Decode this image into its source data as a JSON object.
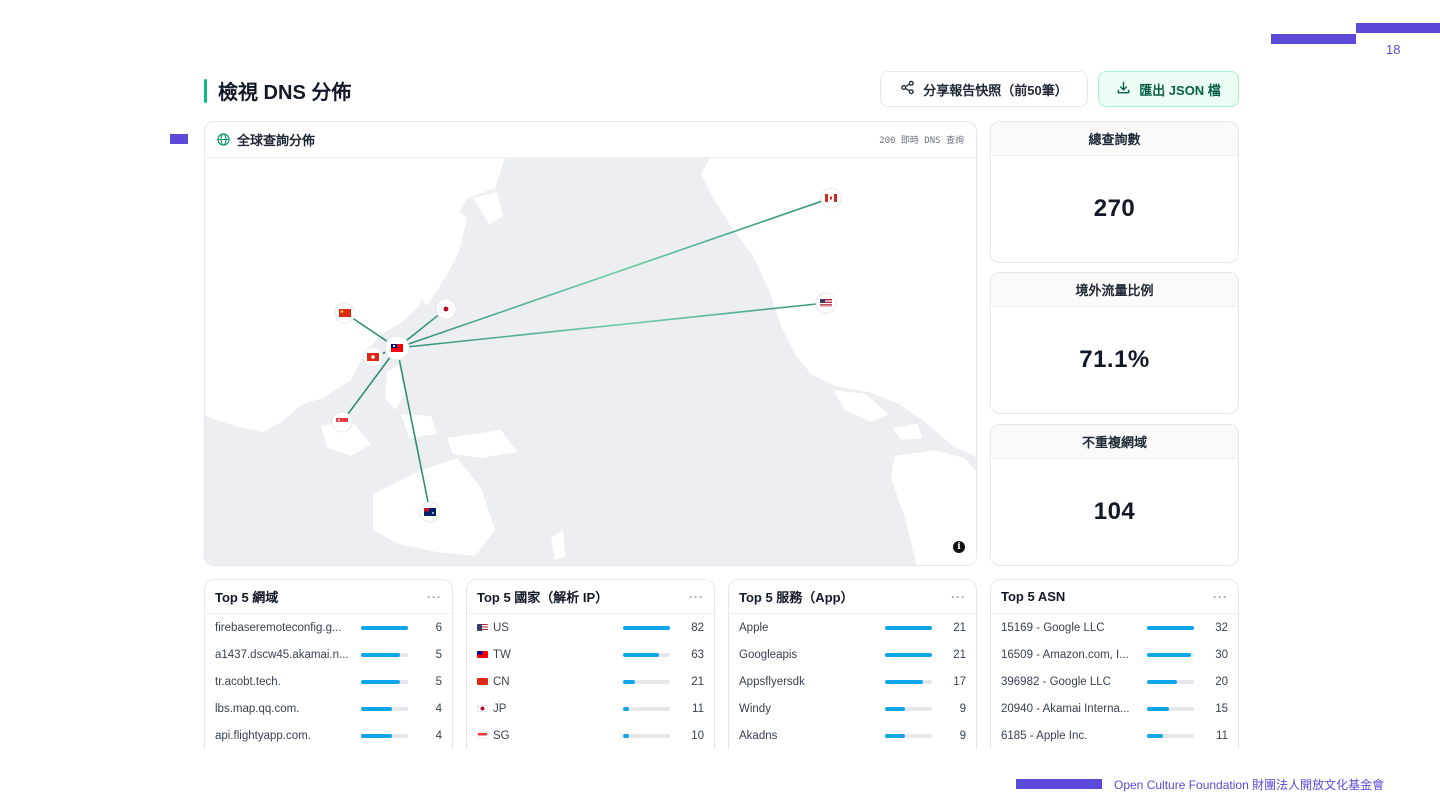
{
  "page_number": "18",
  "title": "檢視 DNS 分佈",
  "buttons": {
    "share": "分享報告快照（前50筆）",
    "export": "匯出 JSON 檔"
  },
  "map": {
    "title": "全球查詢分佈",
    "live_count": "200 即時 DNS 查詢",
    "hub": "TW",
    "markers": [
      "CA",
      "US",
      "JP",
      "CN",
      "HK",
      "TW",
      "SG",
      "AU"
    ]
  },
  "stats": [
    {
      "label": "總查詢數",
      "value": "270"
    },
    {
      "label": "境外流量比例",
      "value": "71.1%"
    },
    {
      "label": "不重複網域",
      "value": "104"
    }
  ],
  "top_lists": [
    {
      "title": "Top 5 網域",
      "rows": [
        {
          "label": "firebaseremoteconfig.g...",
          "value": "6",
          "ratio": 1.0
        },
        {
          "label": "a1437.dscw45.akamai.n...",
          "value": "5",
          "ratio": 0.83
        },
        {
          "label": "tr.acobt.tech.",
          "value": "5",
          "ratio": 0.83
        },
        {
          "label": "lbs.map.qq.com.",
          "value": "4",
          "ratio": 0.67
        },
        {
          "label": "api.flightyapp.com.",
          "value": "4",
          "ratio": 0.67
        }
      ]
    },
    {
      "title": "Top 5 國家（解析 IP）",
      "rows": [
        {
          "label": "US",
          "flag": "us-flag",
          "value": "82",
          "ratio": 1.0
        },
        {
          "label": "TW",
          "flag": "tw-flag",
          "value": "63",
          "ratio": 0.77
        },
        {
          "label": "CN",
          "flag": "cn-flag",
          "value": "21",
          "ratio": 0.26
        },
        {
          "label": "JP",
          "flag": "jp-flag",
          "value": "11",
          "ratio": 0.13
        },
        {
          "label": "SG",
          "flag": "sg-flag",
          "value": "10",
          "ratio": 0.12
        }
      ]
    },
    {
      "title": "Top 5 服務（App）",
      "rows": [
        {
          "label": "Apple",
          "value": "21",
          "ratio": 1.0
        },
        {
          "label": "Googleapis",
          "value": "21",
          "ratio": 1.0
        },
        {
          "label": "Appsflyersdk",
          "value": "17",
          "ratio": 0.81
        },
        {
          "label": "Windy",
          "value": "9",
          "ratio": 0.43
        },
        {
          "label": "Akadns",
          "value": "9",
          "ratio": 0.43
        }
      ]
    },
    {
      "title": "Top 5 ASN",
      "rows": [
        {
          "label": "15169 - Google LLC",
          "value": "32",
          "ratio": 1.0
        },
        {
          "label": "16509 - Amazon.com, I...",
          "value": "30",
          "ratio": 0.94
        },
        {
          "label": "396982 - Google LLC",
          "value": "20",
          "ratio": 0.63
        },
        {
          "label": "20940 - Akamai Interna...",
          "value": "15",
          "ratio": 0.47
        },
        {
          "label": "6185 - Apple Inc.",
          "value": "11",
          "ratio": 0.34
        }
      ]
    }
  ],
  "footer": "Open Culture Foundation 財團法人開放文化基金會",
  "colors": {
    "accent": "#10b981",
    "brand": "#5b4ad8",
    "bar": "#0ea5e9",
    "line": "#2f8f73"
  }
}
